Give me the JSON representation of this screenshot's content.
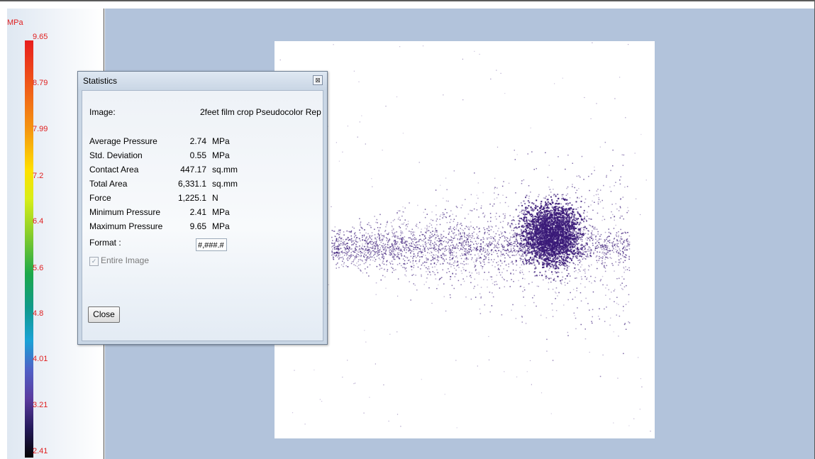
{
  "legend": {
    "unit": "MPa",
    "ticks": [
      "9.65",
      "8.79",
      "7.99",
      "7.2",
      "6.4",
      "5.6",
      "4.8",
      "4.01",
      "3.21",
      "2.41"
    ]
  },
  "dialog": {
    "title": "Statistics",
    "close_icon_glyph": "⊠",
    "image_label": "Image:",
    "image_name": "2feet film crop Pseudocolor Rep",
    "stats": [
      {
        "label": "Average Pressure",
        "value": "2.74",
        "unit": "MPa"
      },
      {
        "label": "Std. Deviation",
        "value": "0.55",
        "unit": "MPa"
      },
      {
        "label": "Contact Area",
        "value": "447.17",
        "unit": "sq.mm"
      },
      {
        "label": "Total Area",
        "value": "6,331.1",
        "unit": "sq.mm"
      },
      {
        "label": "Force",
        "value": "1,225.1",
        "unit": "N"
      },
      {
        "label": "Minimum Pressure",
        "value": "2.41",
        "unit": "MPa"
      },
      {
        "label": "Maximum Pressure",
        "value": "9.65",
        "unit": "MPa"
      }
    ],
    "format_label": "Format :",
    "format_value": "#,###.#",
    "entire_image_label": "Entire Image",
    "entire_image_checked": true,
    "close_button": "Close"
  },
  "colors": {
    "legend_text": "#e02020",
    "main_background": "#b2c3db",
    "pressure_dots": "#3a1a78"
  }
}
